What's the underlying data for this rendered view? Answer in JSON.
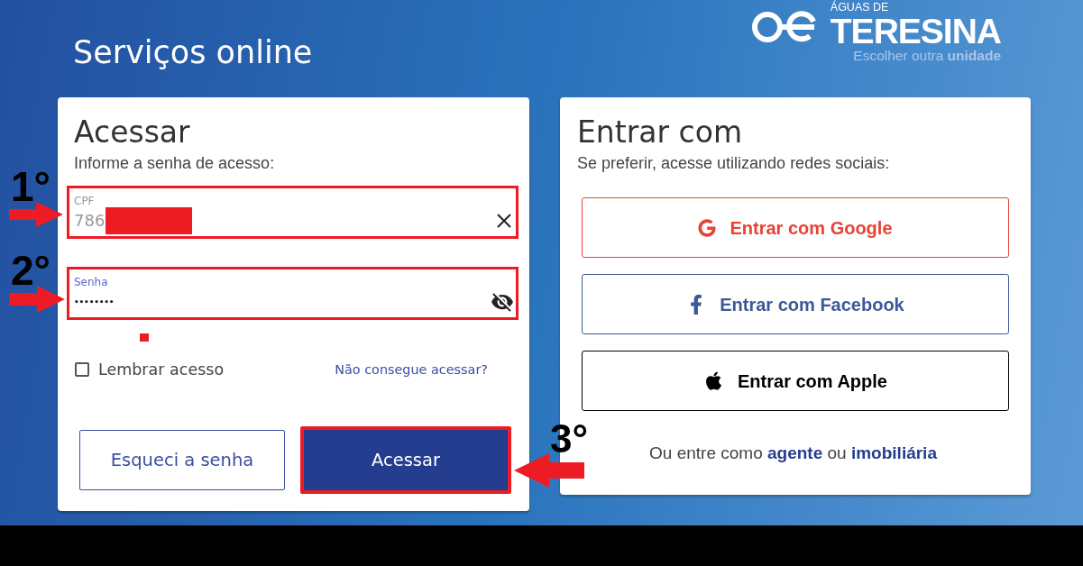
{
  "header": {
    "title": "Serviços online",
    "logo": {
      "top_line": "ÁGUAS DE",
      "name": "TERESINA",
      "switch_link": "Escolher outra **unidade**"
    }
  },
  "login_card": {
    "title": "Acessar",
    "subtitle": "Informe a senha de acesso:",
    "fields": [
      {
        "kind": "text",
        "label": "CPF",
        "value": "786",
        "focused": false,
        "redacted": true,
        "highlighted": true
      },
      {
        "kind": "password",
        "label": "Senha",
        "value": "••••••••",
        "focused": true,
        "redacted": false,
        "highlighted": true
      }
    ],
    "remember": {
      "label": "Lembrar acesso",
      "checked": false
    },
    "help_link": "Não consegue acessar?",
    "buttons": [
      {
        "kind": "outline",
        "label": "Esqueci a senha",
        "highlighted": false
      },
      {
        "kind": "primary",
        "label": "Acessar",
        "highlighted": true
      }
    ]
  },
  "social_card": {
    "title": "Entrar com",
    "subtitle": "Se preferir, acesse utilizando redes sociais:",
    "providers": [
      {
        "kind": "google",
        "label": "Entrar com Google",
        "color": "#e84235"
      },
      {
        "kind": "facebook",
        "label": "Entrar com Facebook",
        "color": "#3b5998"
      },
      {
        "kind": "apple",
        "label": "Entrar com Apple",
        "color": "#000000"
      }
    ],
    "alt_login": {
      "prefix": "Ou entre como",
      "separator": "ou",
      "links": [
        {
          "label": "agente"
        },
        {
          "label": "imobiliária"
        }
      ]
    }
  },
  "annotations": [
    {
      "label": "1°",
      "kind": "right"
    },
    {
      "label": "2°",
      "kind": "right"
    },
    {
      "label": "3°",
      "kind": "left"
    }
  ]
}
